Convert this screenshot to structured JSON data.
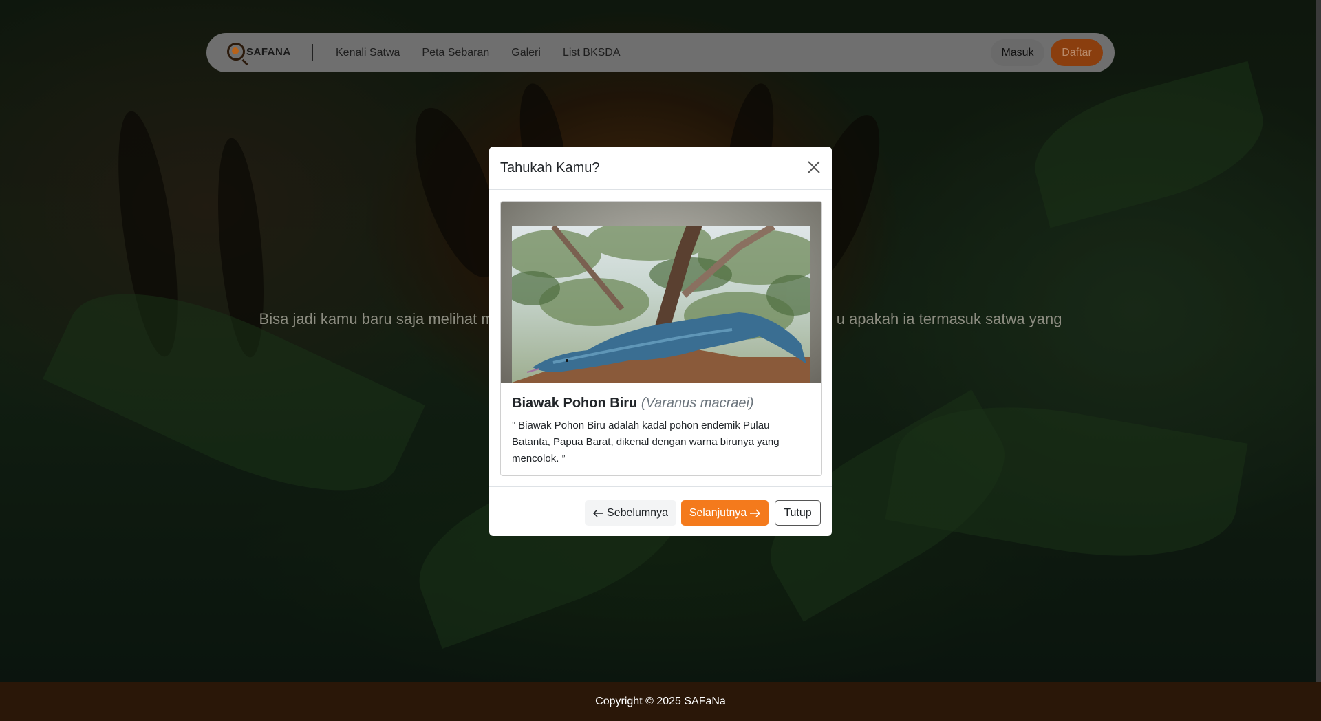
{
  "nav": {
    "logo_text": "SAFANA",
    "links": [
      "Kenali Satwa",
      "Peta Sebaran",
      "Galeri",
      "List BKSDA"
    ],
    "login_label": "Masuk",
    "register_label": "Daftar"
  },
  "hero": {
    "text_left": "Bisa jadi kamu baru saja melihat m",
    "text_right": "u apakah ia termasuk satwa yang"
  },
  "modal": {
    "title": "Tahukah Kamu?",
    "animal_name": "Biawak Pohon Biru",
    "scientific_name": "(Varanus macraei)",
    "description": "” Biawak Pohon Biru adalah kadal pohon endemik Pulau Batanta, Papua Barat, dikenal dengan warna birunya yang mencolok. ”",
    "prev_label": "Sebelumnya",
    "next_label": "Selanjutnya",
    "close_label": "Tutup"
  },
  "footer": {
    "copyright": "Copyright © 2025 SAFaNa"
  },
  "colors": {
    "accent": "#f47a1c",
    "footer_bg": "#2a1708"
  }
}
